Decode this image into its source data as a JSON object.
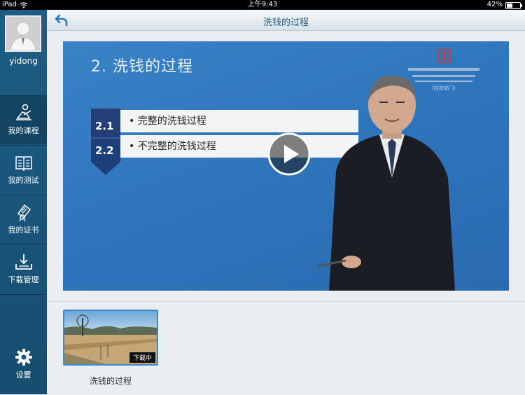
{
  "status_bar": {
    "device": "iPad",
    "time": "上午9:43",
    "battery": "42%",
    "battery_level": 0.42
  },
  "sidebar": {
    "username": "yidong",
    "items": [
      {
        "label": "我的课程",
        "icon": "course-reader-icon"
      },
      {
        "label": "我的测试",
        "icon": "open-book-icon"
      },
      {
        "label": "我的证书",
        "icon": "certificate-icon"
      },
      {
        "label": "下载管理",
        "icon": "download-tray-icon"
      }
    ],
    "settings_label": "设置"
  },
  "topbar": {
    "title": "洗钱的过程"
  },
  "video": {
    "slide_title": "2.  洗钱的过程",
    "bullets": [
      {
        "num": "2.1",
        "text": "• 完整的洗钱过程"
      },
      {
        "num": "2.2",
        "text": "• 不完整的洗钱过程"
      }
    ],
    "logo_caption": "(财政部门)"
  },
  "downloads": [
    {
      "caption": "洗钱的过程",
      "badge": "下载中"
    }
  ],
  "colors": {
    "sidebar": "#1d5d84",
    "accent": "#1e5b86",
    "slide_bg": "#2f76bd"
  }
}
